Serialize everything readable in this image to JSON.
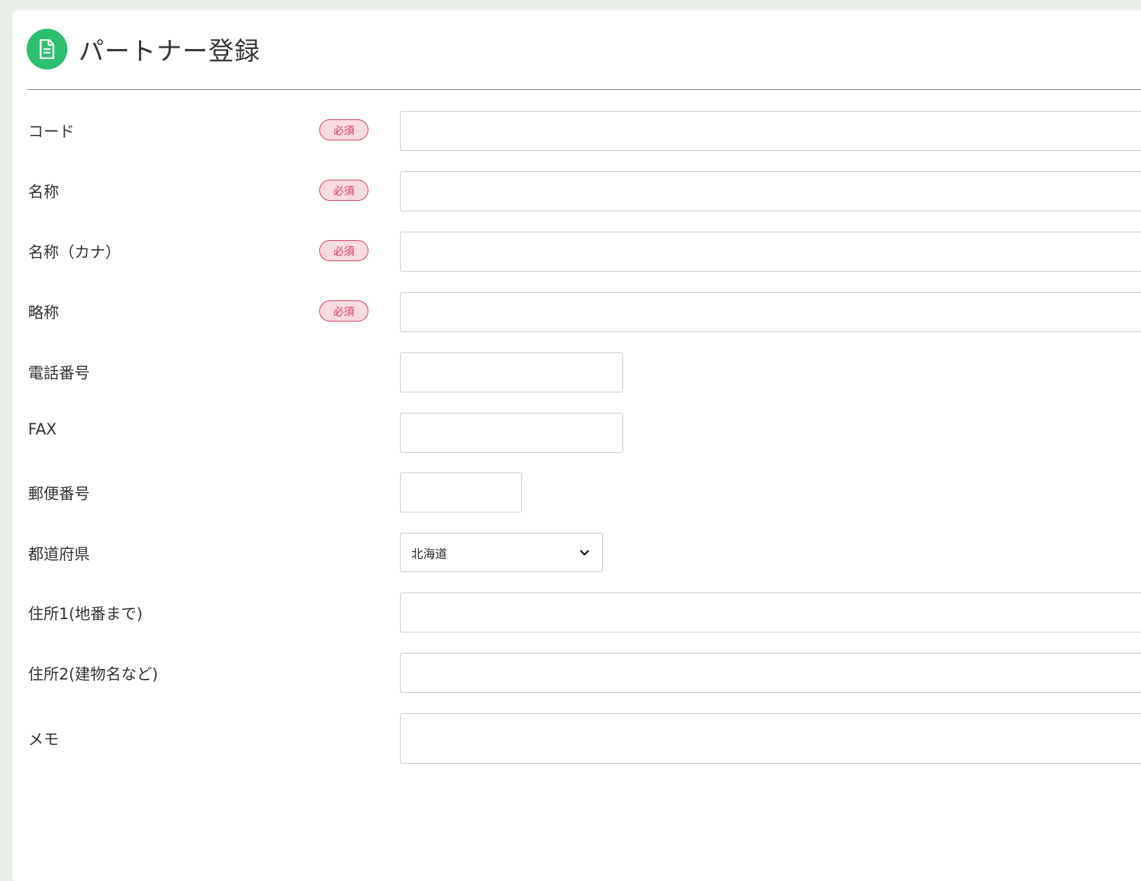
{
  "page": {
    "title": "パートナー登録",
    "title_icon": "document-icon",
    "accent_color": "#2bbf6e",
    "required_color": "#d9345a"
  },
  "form": {
    "required_label": "必須",
    "fields": {
      "code": {
        "label": "コード",
        "required": true,
        "value": ""
      },
      "name": {
        "label": "名称",
        "required": true,
        "value": ""
      },
      "name_kana": {
        "label": "名称（カナ）",
        "required": true,
        "value": ""
      },
      "short_name": {
        "label": "略称",
        "required": true,
        "value": ""
      },
      "phone": {
        "label": "電話番号",
        "required": false,
        "value": ""
      },
      "fax": {
        "label": "FAX",
        "required": false,
        "value": ""
      },
      "postal_code": {
        "label": "郵便番号",
        "required": false,
        "value": ""
      },
      "prefecture": {
        "label": "都道府県",
        "required": false,
        "value": "北海道",
        "icon": "chevron-down-icon"
      },
      "address1": {
        "label": "住所1(地番まで)",
        "required": false,
        "value": ""
      },
      "address2": {
        "label": "住所2(建物名など)",
        "required": false,
        "value": ""
      },
      "memo": {
        "label": "メモ",
        "required": false,
        "value": ""
      }
    }
  }
}
